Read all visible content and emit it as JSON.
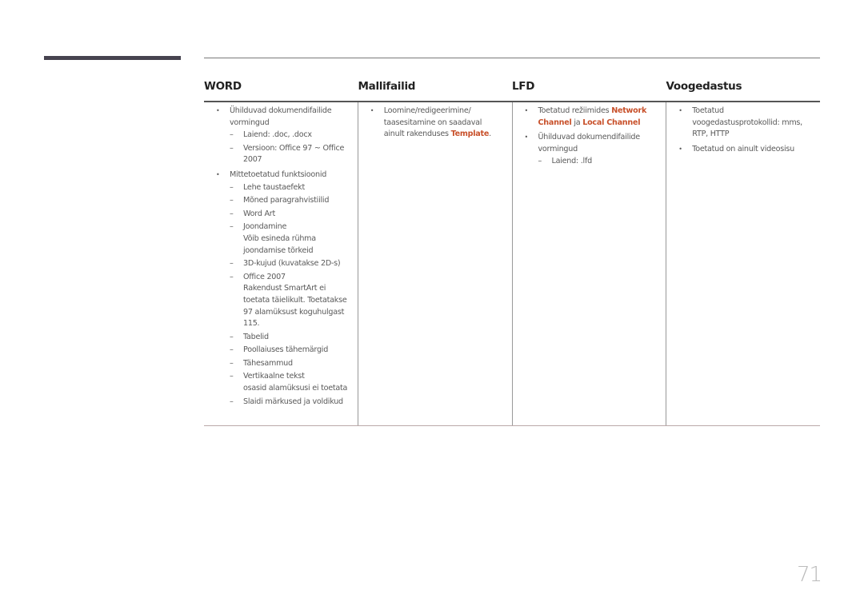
{
  "headers": [
    "WORD",
    "Mallifailid",
    "LFD",
    "Voogedastus"
  ],
  "word": {
    "b1": "Ühilduvad dokumendifailide vormingud",
    "b1_sub": [
      "Laiend: .doc, .docx",
      "Versioon: Office 97 ~ Office 2007"
    ],
    "b2": "Mittetoetatud funktsioonid",
    "b2_sub": [
      "Lehe taustaefekt",
      "Mõned paragrahvistiilid",
      "Word Art",
      "Joondamine",
      "Võib esineda rühma joondamise tõrkeid",
      "3D-kujud (kuvatakse 2D-s)",
      "Office 2007",
      "Rakendust SmartArt ei toetata täielikult. Toetatakse 97 alamüksust koguhulgast 115.",
      "Tabelid",
      "Poollaiuses tähemärgid",
      "Tähesammud",
      "Vertikaalne tekst",
      "osasid alamüksusi ei toetata",
      "Slaidi märkused ja voldikud"
    ]
  },
  "template": {
    "b1_text": "Loomine/redigeerimine/ taasesitamine on saadaval ainult rakenduses ",
    "b1_hl": "Template",
    "b1_end": "."
  },
  "lfd": {
    "b1_text": "Toetatud režiimides ",
    "b1_hl1": "Network Channel",
    "b1_mid": " ja ",
    "b1_hl2": "Local Channel",
    "b2": "Ühilduvad dokumendifailide vormingud",
    "b2_sub": [
      "Laiend: .lfd"
    ]
  },
  "streaming": {
    "b1": "Toetatud voogedastusprotokollid: mms, RTP, HTTP",
    "b2": "Toetatud on ainult videosisu"
  },
  "page_number": "71",
  "colors": {
    "highlight": "#c8502a",
    "side_bar": "#46434f"
  }
}
